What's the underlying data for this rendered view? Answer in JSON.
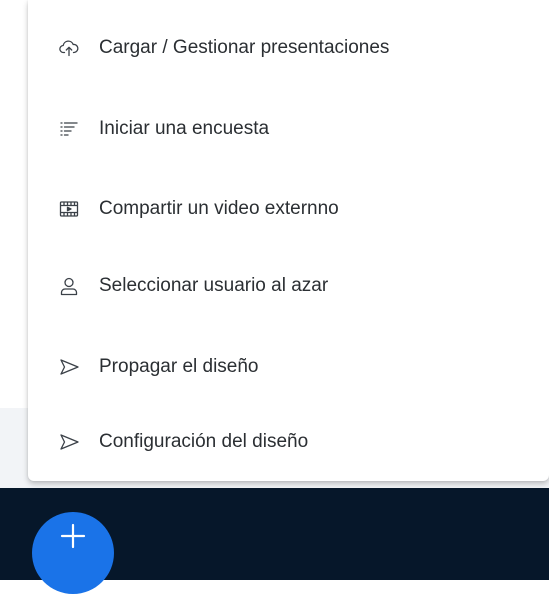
{
  "menu": {
    "items": [
      {
        "label": "Cargar / Gestionar presentaciones",
        "icon": "cloud-upload-icon"
      },
      {
        "label": "Iniciar una encuesta",
        "icon": "poll-list-icon"
      },
      {
        "label": "Compartir un video externno",
        "icon": "video-icon"
      },
      {
        "label": "Seleccionar usuario al azar",
        "icon": "user-icon"
      },
      {
        "label": "Propagar el diseño",
        "icon": "send-icon"
      },
      {
        "label": "Configuración del diseño",
        "icon": "send-icon"
      }
    ]
  },
  "fab": {
    "icon": "plus-icon"
  },
  "colors": {
    "fab": "#1a73e8",
    "bottom_bar": "#06172a",
    "band": "#f2f4f7",
    "text": "#2b2f33"
  }
}
